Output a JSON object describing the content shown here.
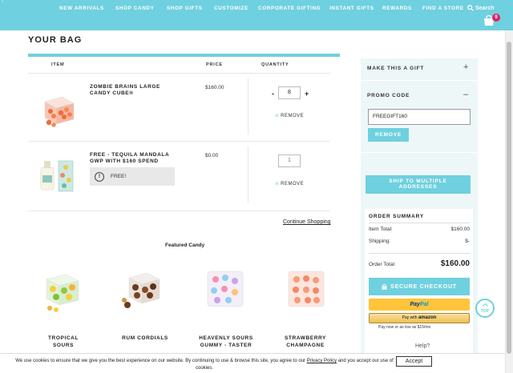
{
  "header": {
    "nav": [
      "NEW ARRIVALS",
      "SHOP CANDY",
      "SHOP GIFTS",
      "CUSTOMIZE",
      "CORPORATE GIFTING",
      "INSTANT GIFTS",
      "REWARDS",
      "FIND A STORE"
    ],
    "search_label": "Search",
    "bag_count": "9",
    "search_icon": "search-icon",
    "bag_icon": "shopping-bag-icon",
    "accent": "#6fd0df",
    "badge_color": "#e0216b"
  },
  "bag": {
    "title": "YOUR BAG",
    "columns": {
      "item": "ITEM",
      "price": "PRICE",
      "quantity": "QUANTITY"
    },
    "items": [
      {
        "name": "ZOMBIE BRAINS LARGE CANDY CUBE®",
        "price": "$160.00",
        "quantity": "8",
        "minus": "-",
        "plus": "+",
        "remove": "REMOVE"
      },
      {
        "name": "FREE - TEQUILA MANDALA GWP WITH $160 SPEND",
        "price": "$0.00",
        "quantity": "1",
        "remove": "REMOVE",
        "banner": "FREE!"
      }
    ],
    "continue_shopping": "Continue Shopping"
  },
  "featured": {
    "title": "Featured Candy",
    "items": [
      {
        "name": "TROPICAL SOURS"
      },
      {
        "name": "RUM CORDIALS"
      },
      {
        "name_line1": "HEAVENLY SOURS",
        "name_line2": "GUMMY - TASTER"
      },
      {
        "name_line1": "STRAWBERRY",
        "name_line2": "CHAMPAGNE"
      }
    ]
  },
  "sidebar": {
    "make_gift": "MAKE THIS A GIFT",
    "make_gift_sign": "+",
    "promo_title": "PROMO CODE",
    "promo_sign": "–",
    "promo_value": "FREEGIFT160",
    "promo_remove": "REMOVE",
    "ship_line1": "SHIP TO MULTIPLE",
    "ship_line2": "ADDRESSES",
    "summary_title": "ORDER SUMMARY",
    "item_total_label": "Item Total:",
    "item_total_value": "$160.00",
    "shipping_label": "Shipping:",
    "shipping_value": "$-",
    "order_total_label": "Order Total",
    "order_total_value": "$160.00",
    "checkout": "SECURE CHECKOUT",
    "paypal_a": "Pay",
    "paypal_b": "Pal",
    "amazon_prefix": "Pay with",
    "amazon_logo": "amazon",
    "pay_later": "Pay now or as low as $15/mo",
    "help": "Help?"
  },
  "back_to_top": "TOP",
  "cookie": {
    "text_before": "We use cookies to ensure that we give you the best experience on our website. By continuing to use & browse this site, you agree to our",
    "link": "Privacy Policy",
    "text_after": "and you accept our use of cookies.",
    "accept": "Accept"
  }
}
